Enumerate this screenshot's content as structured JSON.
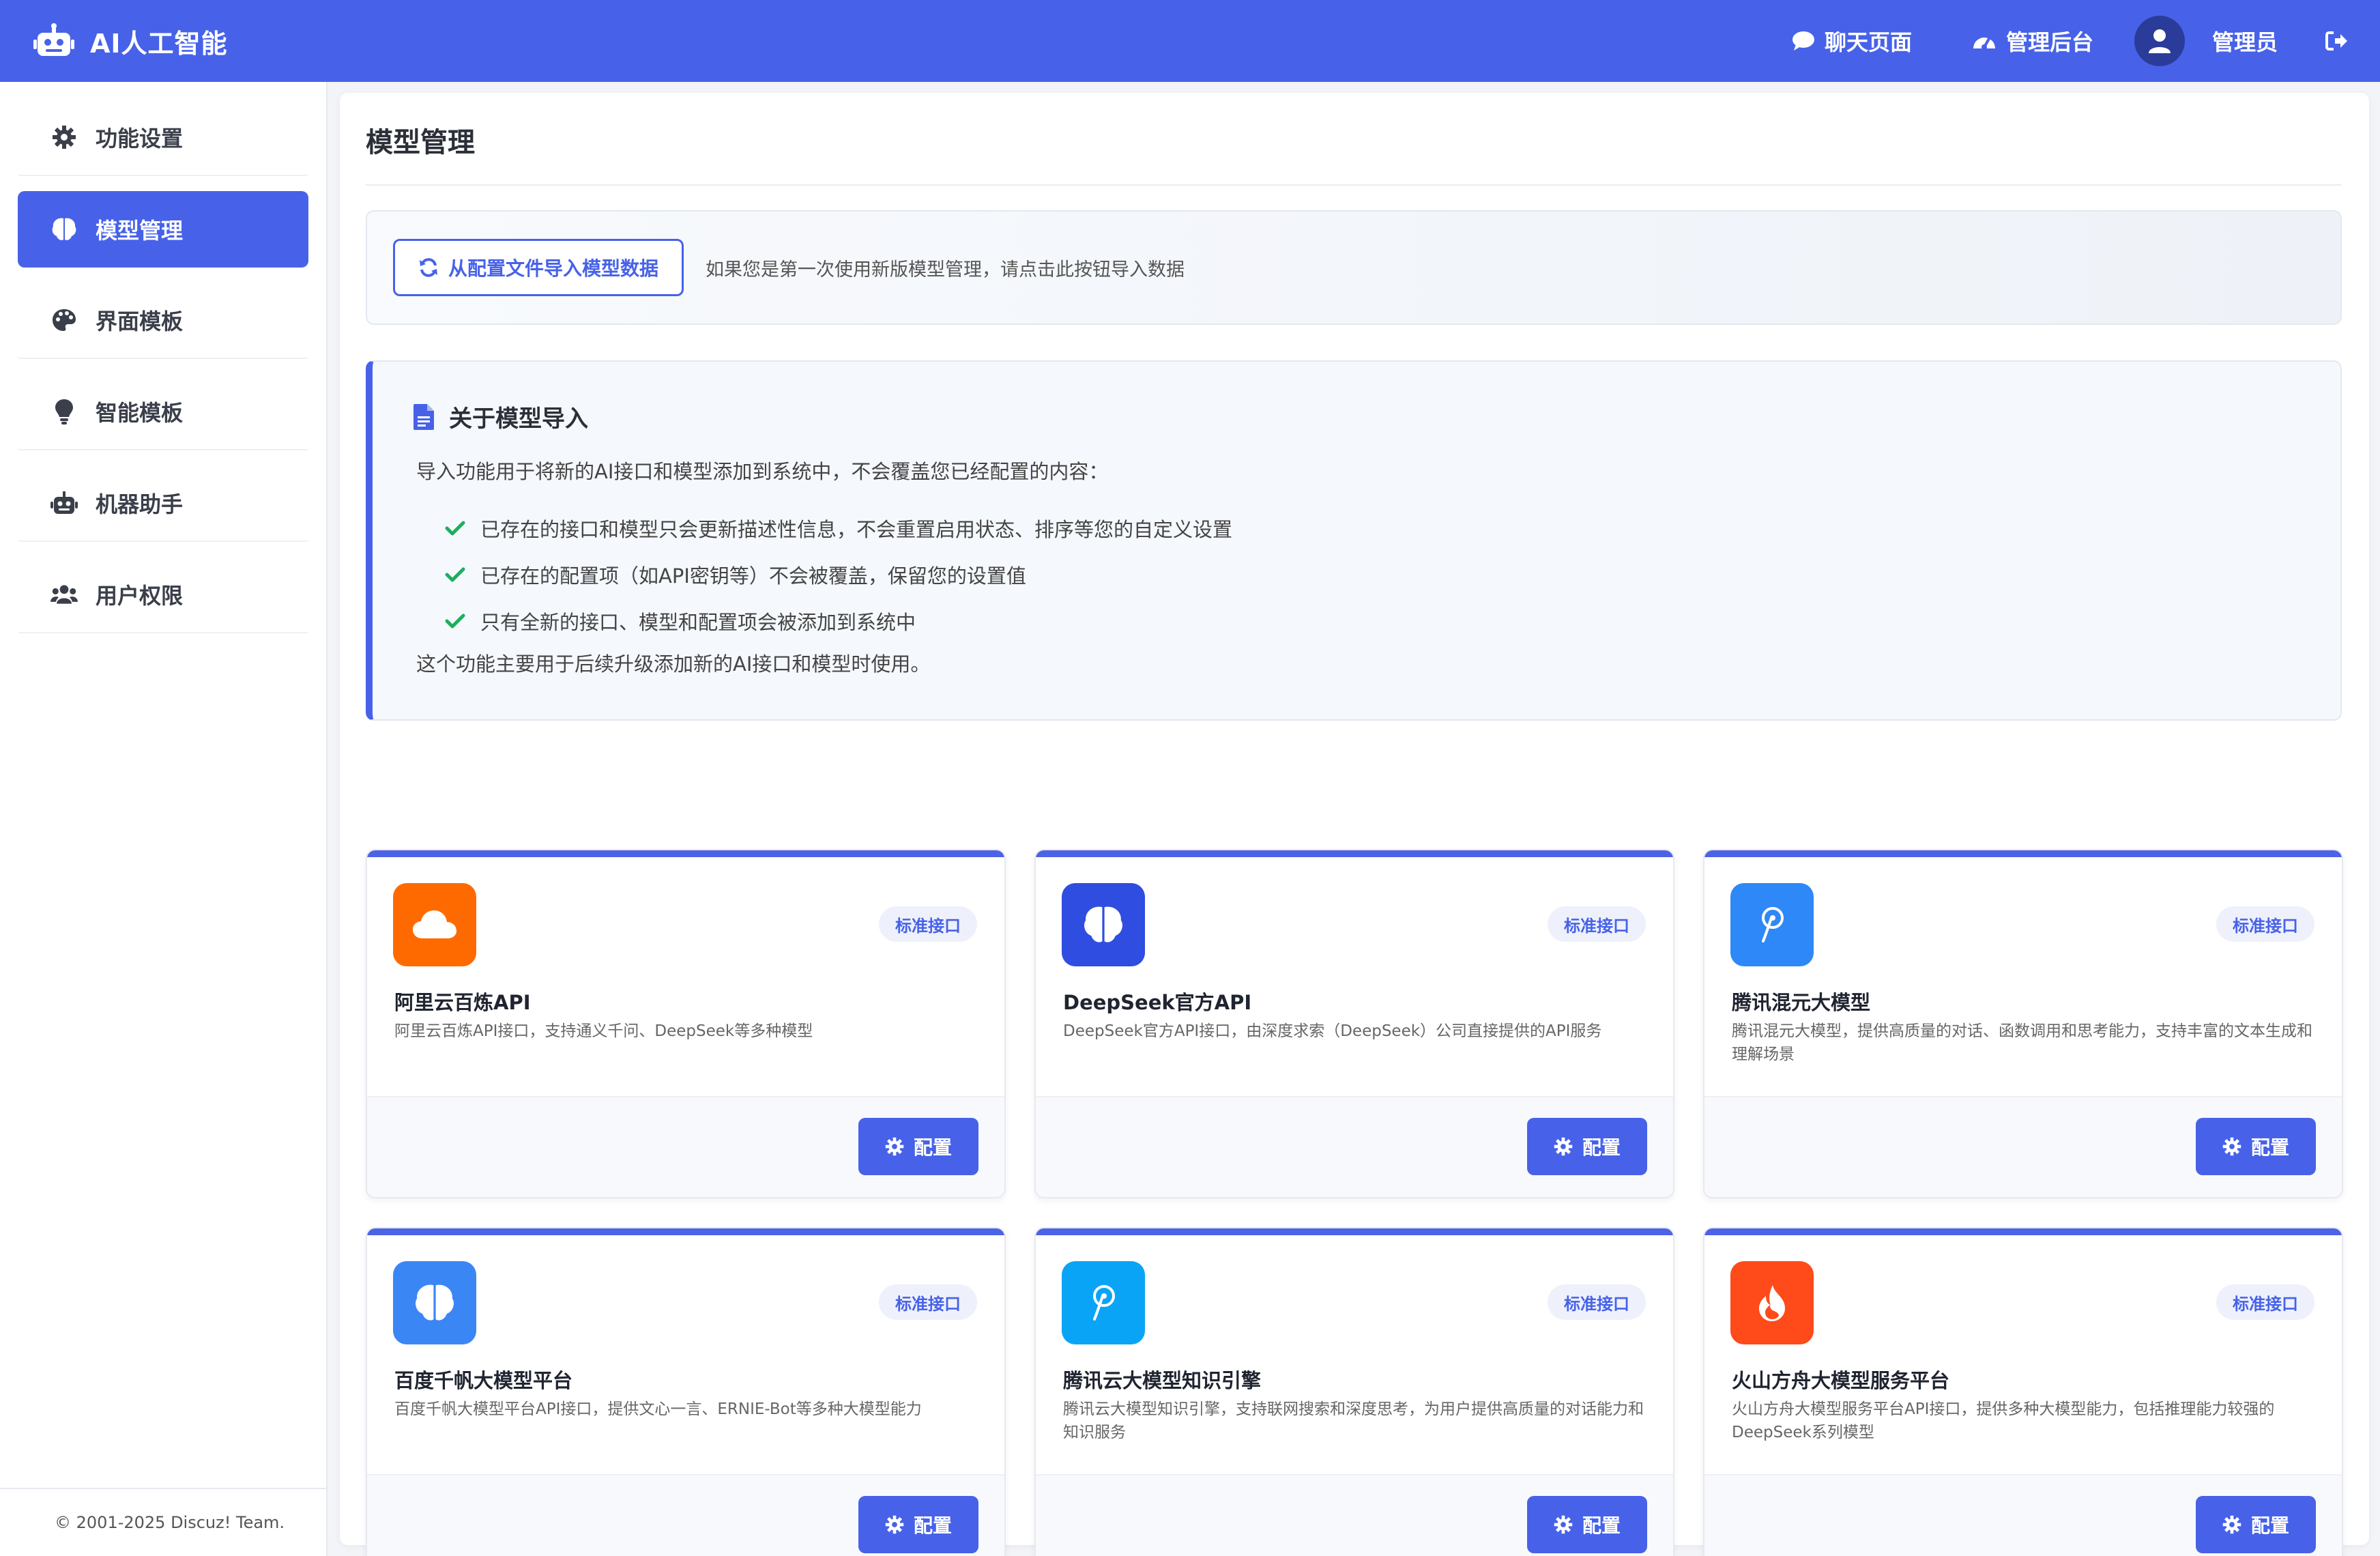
{
  "header": {
    "brand_title": "AI人工智能",
    "nav_chat": "聊天页面",
    "nav_admin": "管理后台",
    "username": "管理员",
    "accent_color": "#4762e8"
  },
  "sidebar": {
    "items": [
      {
        "label": "功能设置",
        "icon": "gear-icon",
        "active": false
      },
      {
        "label": "模型管理",
        "icon": "brain-icon",
        "active": true
      },
      {
        "label": "界面模板",
        "icon": "palette-icon",
        "active": false
      },
      {
        "label": "智能模板",
        "icon": "lightbulb-icon",
        "active": false
      },
      {
        "label": "机器助手",
        "icon": "robot-icon",
        "active": false
      },
      {
        "label": "用户权限",
        "icon": "users-icon",
        "active": false
      }
    ],
    "footer": "© 2001-2025 Discuz! Team."
  },
  "main": {
    "title": "模型管理",
    "import_button": "从配置文件导入模型数据",
    "import_hint": "如果您是第一次使用新版模型管理，请点击此按钮导入数据",
    "info": {
      "title": "关于模型导入",
      "intro": "导入功能用于将新的AI接口和模型添加到系统中，不会覆盖您已经配置的内容：",
      "points": [
        "已存在的接口和模型只会更新描述性信息，不会重置启用状态、排序等您的自定义设置",
        "已存在的配置项（如API密钥等）不会被覆盖，保留您的设置值",
        "只有全新的接口、模型和配置项会被添加到系统中"
      ],
      "outro": "这个功能主要用于后续升级添加新的AI接口和模型时使用。"
    },
    "cards": [
      {
        "name": "阿里云百炼API",
        "desc": "阿里云百炼API接口，支持通义千问、DeepSeek等多种模型",
        "badge": "标准接口",
        "button": "配置",
        "logo_color": "#ff6a00",
        "icon": "cloud-icon"
      },
      {
        "name": "DeepSeek官方API",
        "desc": "DeepSeek官方API接口，由深度求索（DeepSeek）公司直接提供的API服务",
        "badge": "标准接口",
        "button": "配置",
        "logo_color": "#2f4de0",
        "icon": "brain-icon"
      },
      {
        "name": "腾讯混元大模型",
        "desc": "腾讯混元大模型，提供高质量的对话、函数调用和思考能力，支持丰富的文本生成和理解场景",
        "badge": "标准接口",
        "button": "配置",
        "logo_color": "#2e88f7",
        "icon": "hunyuan-icon"
      },
      {
        "name": "百度千帆大模型平台",
        "desc": "百度千帆大模型平台API接口，提供文心一言、ERNIE-Bot等多种大模型能力",
        "badge": "标准接口",
        "button": "配置",
        "logo_color": "#3b86f5",
        "icon": "brain-icon"
      },
      {
        "name": "腾讯云大模型知识引擎",
        "desc": "腾讯云大模型知识引擎，支持联网搜索和深度思考，为用户提供高质量的对话能力和知识服务",
        "badge": "标准接口",
        "button": "配置",
        "logo_color": "#0aa4f6",
        "icon": "hunyuan-icon"
      },
      {
        "name": "火山方舟大模型服务平台",
        "desc": "火山方舟大模型服务平台API接口，提供多种大模型能力，包括推理能力较强的DeepSeek系列模型",
        "badge": "标准接口",
        "button": "配置",
        "logo_color": "#ff4a1a",
        "icon": "fire-icon"
      }
    ]
  }
}
